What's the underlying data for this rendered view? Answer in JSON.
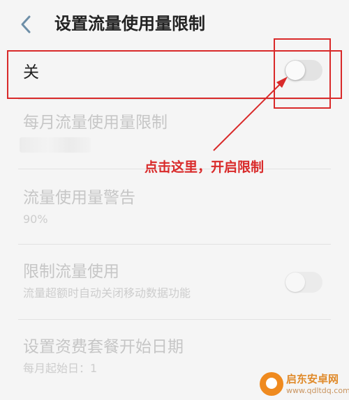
{
  "header": {
    "title": "设置流量使用量限制",
    "back_icon": "chevron-left-icon"
  },
  "settings": {
    "master_switch": {
      "label": "关",
      "toggle_on": false
    },
    "monthly_limit": {
      "title": "每月流量使用量限制",
      "value_obscured": true
    },
    "usage_warning": {
      "title": "流量使用量警告",
      "subtitle": "90%"
    },
    "limit_usage": {
      "title": "限制流量使用",
      "subtitle": "流量超额时自动关闭移动数据功能",
      "toggle_on": false
    },
    "billing_start": {
      "title": "设置资费套餐开始日期",
      "subtitle": "每月起始日：1"
    }
  },
  "annotation": {
    "text": "点击这里，开启限制",
    "color": "#d92a2a"
  },
  "watermark": {
    "brand": "启东安卓网",
    "url": "www.qdltdq.com"
  },
  "colors": {
    "background": "#f5f5f5",
    "accent_red": "#d92a2a",
    "text_dim": "#c6c6c6"
  }
}
